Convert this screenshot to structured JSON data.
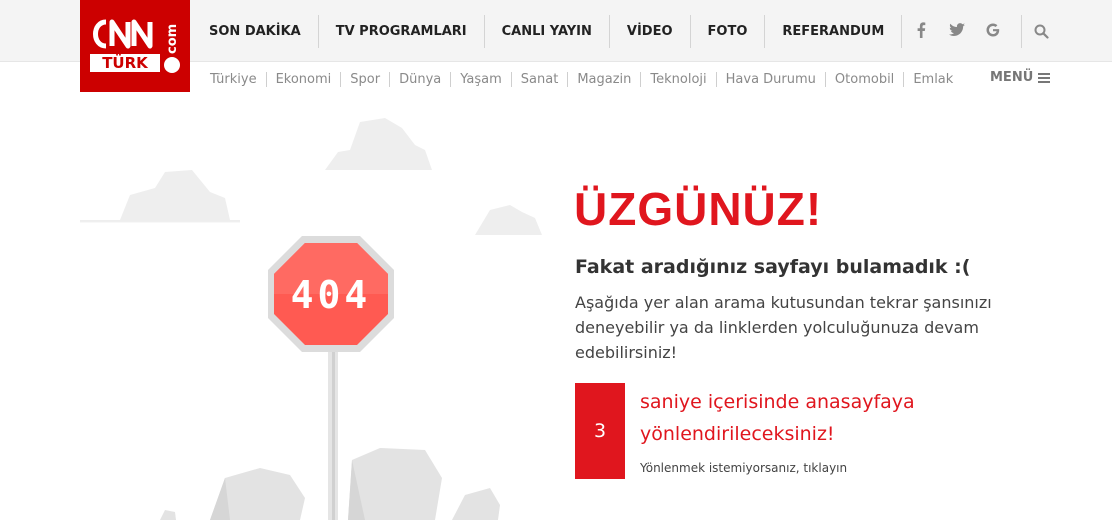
{
  "logo": {
    "text": "CNN TÜRK .com",
    "color": "#cc0000"
  },
  "main_nav": [
    "SON DAKİKA",
    "TV PROGRAMLARI",
    "CANLI YAYIN",
    "VİDEO",
    "FOTO",
    "REFERANDUM"
  ],
  "social": [
    {
      "icon": "facebook-icon",
      "glyph": "f"
    },
    {
      "icon": "twitter-icon",
      "glyph": "🐦"
    },
    {
      "icon": "google-plus-icon",
      "glyph": "G"
    }
  ],
  "search": {
    "icon": "search-icon"
  },
  "sub_nav": [
    "Türkiye",
    "Ekonomi",
    "Spor",
    "Dünya",
    "Yaşam",
    "Sanat",
    "Magazin",
    "Teknoloji",
    "Hava Durumu",
    "Otomobil",
    "Emlak"
  ],
  "menu": {
    "label": "MENÜ",
    "icon": "hamburger-icon"
  },
  "illustration": {
    "sign_text": "404",
    "sign_color": "#ff5a52"
  },
  "error": {
    "title": "ÜZGÜNÜZ!",
    "subtitle": "Fakat aradığınız sayfayı bulamadık :(",
    "description": "Aşağıda yer alan arama kutusundan tekrar şansınızı deneyebilir ya da linklerden yolculuğunuza devam edebilirsiniz!",
    "countdown": "3",
    "redirect_text": "saniye içerisinde anasayfaya yönlendirileceksiniz!",
    "cancel_text": "Yönlenmek istemiyorsanız, tıklayın"
  },
  "colors": {
    "accent": "#e0161e",
    "header_bg": "#f4f4f4"
  }
}
